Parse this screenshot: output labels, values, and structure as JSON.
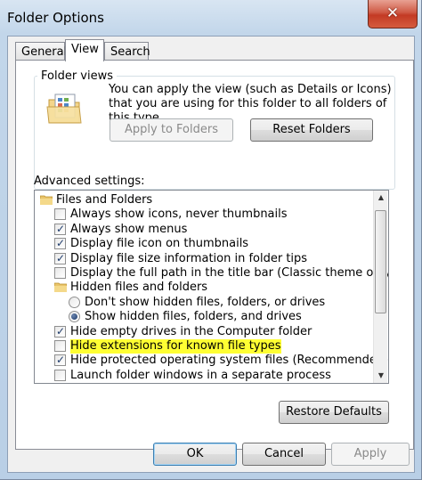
{
  "window": {
    "title": "Folder Options"
  },
  "tabs": [
    {
      "label": "General",
      "active": false
    },
    {
      "label": "View",
      "active": true
    },
    {
      "label": "Search",
      "active": false
    }
  ],
  "folder_views": {
    "label": "Folder views",
    "description": "You can apply the view (such as Details or Icons) that you are using for this folder to all folders of this type.",
    "apply_button": "Apply to Folders",
    "reset_button": "Reset Folders"
  },
  "advanced": {
    "label": "Advanced settings:",
    "items": [
      {
        "kind": "folder",
        "label": "Files and Folders",
        "indent": 0
      },
      {
        "kind": "checkbox",
        "label": "Always show icons, never thumbnails",
        "checked": false,
        "indent": 1
      },
      {
        "kind": "checkbox",
        "label": "Always show menus",
        "checked": true,
        "indent": 1
      },
      {
        "kind": "checkbox",
        "label": "Display file icon on thumbnails",
        "checked": true,
        "indent": 1
      },
      {
        "kind": "checkbox",
        "label": "Display file size information in folder tips",
        "checked": true,
        "indent": 1
      },
      {
        "kind": "checkbox",
        "label": "Display the full path in the title bar (Classic theme only)",
        "checked": false,
        "indent": 1
      },
      {
        "kind": "folder",
        "label": "Hidden files and folders",
        "indent": 1
      },
      {
        "kind": "radio",
        "label": "Don't show hidden files, folders, or drives",
        "checked": false,
        "indent": 2
      },
      {
        "kind": "radio",
        "label": "Show hidden files, folders, and drives",
        "checked": true,
        "indent": 2
      },
      {
        "kind": "checkbox",
        "label": "Hide empty drives in the Computer folder",
        "checked": true,
        "indent": 1
      },
      {
        "kind": "checkbox",
        "label": "Hide extensions for known file types",
        "checked": false,
        "indent": 1,
        "highlight": true
      },
      {
        "kind": "checkbox",
        "label": "Hide protected operating system files (Recommended)",
        "checked": true,
        "indent": 1
      },
      {
        "kind": "checkbox",
        "label": "Launch folder windows in a separate process",
        "checked": false,
        "indent": 1
      }
    ],
    "restore_button": "Restore Defaults"
  },
  "footer": {
    "ok": "OK",
    "cancel": "Cancel",
    "apply": "Apply"
  },
  "colors": {
    "highlight": "#ffff33",
    "close": "#c33a24"
  },
  "icons": {
    "close": "close-icon",
    "checkmark": "✓"
  }
}
